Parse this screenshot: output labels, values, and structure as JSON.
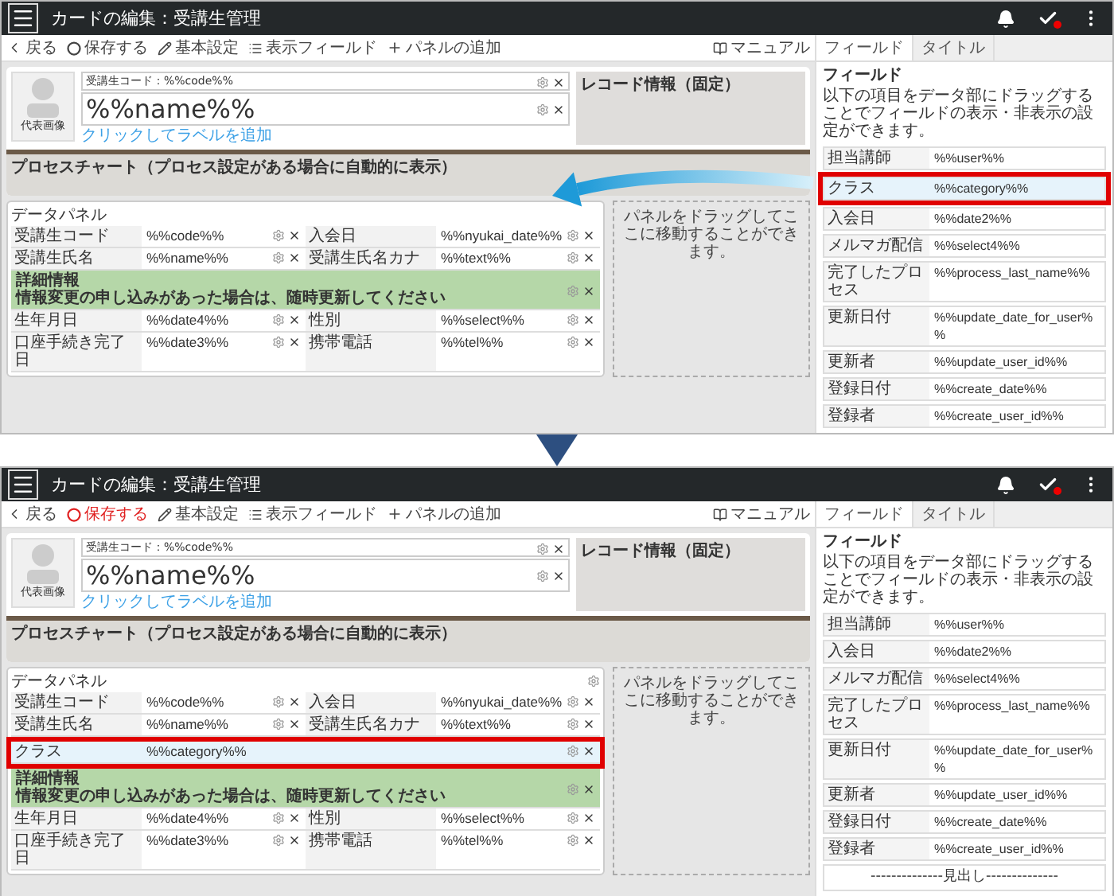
{
  "screens": [
    {
      "title": "カードの編集：受講生管理",
      "toolbar": [
        {
          "kind": "back",
          "label": "戻る",
          "active": false
        },
        {
          "kind": "save",
          "label": "保存する",
          "active": false
        },
        {
          "kind": "settings",
          "label": "基本設定",
          "active": false
        },
        {
          "kind": "fields",
          "label": "表示フィールド",
          "active": false
        },
        {
          "kind": "add",
          "label": "パネルの追加",
          "active": false
        }
      ],
      "manual": "マニュアル",
      "tabs": [
        {
          "label": "フィールド",
          "selected": true
        },
        {
          "label": "タイトル",
          "selected": false
        }
      ],
      "card": {
        "avatar_label": "代表画像",
        "code_label": "受講生コード：%%code%%",
        "name": "%%name%%",
        "label_link": "クリックしてラベルを追加",
        "record_info": "レコード情報（固定）"
      },
      "process_chart": "プロセスチャート（プロセス設定がある場合に自動的に表示）",
      "data_panel": {
        "title": "データパネル",
        "settings_icon": false,
        "rows": [
          {
            "kind": "pair",
            "highlighted": false,
            "cells": [
              {
                "label": "受講生コード",
                "value": "%%code%%"
              },
              {
                "label": "入会日",
                "value": "%%nyukai_date%%"
              }
            ]
          },
          {
            "kind": "pair",
            "highlighted": false,
            "cells": [
              {
                "label": "受講生氏名",
                "value": "%%name%%"
              },
              {
                "label": "受講生氏名カナ",
                "value": "%%text%%"
              }
            ]
          },
          {
            "kind": "section",
            "highlighted": false,
            "title": "詳細情報",
            "note": "情報変更の申し込みがあった場合は、随時更新してください"
          },
          {
            "kind": "pair",
            "highlighted": false,
            "cells": [
              {
                "label": "生年月日",
                "value": "%%date4%%"
              },
              {
                "label": "性別",
                "value": "%%select%%"
              }
            ]
          },
          {
            "kind": "pair",
            "highlighted": false,
            "cells": [
              {
                "label": "口座手続き完了日",
                "value": "%%date3%%"
              },
              {
                "label": "携帯電話",
                "value": "%%tel%%"
              }
            ]
          }
        ]
      },
      "drop_zone": "パネルをドラッグしてここに移動することができます。",
      "sidebar": {
        "heading": "フィールド",
        "description": "以下の項目をデータ部にドラッグすることでフィールドの表示・非表示の設定ができます。",
        "fields": [
          {
            "label": "担当講師",
            "value": "%%user%%",
            "highlighted": false
          },
          {
            "label": "クラス",
            "value": "%%category%%",
            "highlighted": true
          },
          {
            "label": "入会日",
            "value": "%%date2%%",
            "highlighted": false
          },
          {
            "label": "メルマガ配信",
            "value": "%%select4%%",
            "highlighted": false
          },
          {
            "label": "完了したプロセス",
            "value": "%%process_last_name%%",
            "highlighted": false
          },
          {
            "label": "更新日付",
            "value": "%%update_date_for_user%%",
            "highlighted": false
          },
          {
            "label": "更新者",
            "value": "%%update_user_id%%",
            "highlighted": false
          },
          {
            "label": "登録日付",
            "value": "%%create_date%%",
            "highlighted": false
          },
          {
            "label": "登録者",
            "value": "%%create_user_id%%",
            "highlighted": false
          }
        ]
      },
      "drag_arrow": true
    },
    {
      "title": "カードの編集：受講生管理",
      "toolbar": [
        {
          "kind": "back",
          "label": "戻る",
          "active": false
        },
        {
          "kind": "save",
          "label": "保存する",
          "active": true
        },
        {
          "kind": "settings",
          "label": "基本設定",
          "active": false
        },
        {
          "kind": "fields",
          "label": "表示フィールド",
          "active": false
        },
        {
          "kind": "add",
          "label": "パネルの追加",
          "active": false
        }
      ],
      "manual": "マニュアル",
      "tabs": [
        {
          "label": "フィールド",
          "selected": true
        },
        {
          "label": "タイトル",
          "selected": false
        }
      ],
      "card": {
        "avatar_label": "代表画像",
        "code_label": "受講生コード：%%code%%",
        "name": "%%name%%",
        "label_link": "クリックしてラベルを追加",
        "record_info": "レコード情報（固定）"
      },
      "process_chart": "プロセスチャート（プロセス設定がある場合に自動的に表示）",
      "data_panel": {
        "title": "データパネル",
        "settings_icon": true,
        "rows": [
          {
            "kind": "pair",
            "highlighted": false,
            "cells": [
              {
                "label": "受講生コード",
                "value": "%%code%%"
              },
              {
                "label": "入会日",
                "value": "%%nyukai_date%%"
              }
            ]
          },
          {
            "kind": "pair",
            "highlighted": false,
            "cells": [
              {
                "label": "受講生氏名",
                "value": "%%name%%"
              },
              {
                "label": "受講生氏名カナ",
                "value": "%%text%%"
              }
            ]
          },
          {
            "kind": "single",
            "highlighted": true,
            "label": "クラス",
            "value": "%%category%%"
          },
          {
            "kind": "section",
            "highlighted": false,
            "title": "詳細情報",
            "note": "情報変更の申し込みがあった場合は、随時更新してください"
          },
          {
            "kind": "pair",
            "highlighted": false,
            "cells": [
              {
                "label": "生年月日",
                "value": "%%date4%%"
              },
              {
                "label": "性別",
                "value": "%%select%%"
              }
            ]
          },
          {
            "kind": "pair",
            "highlighted": false,
            "cells": [
              {
                "label": "口座手続き完了日",
                "value": "%%date3%%"
              },
              {
                "label": "携帯電話",
                "value": "%%tel%%"
              }
            ]
          }
        ]
      },
      "drop_zone": "パネルをドラッグしてここに移動することができます。",
      "sidebar": {
        "heading": "フィールド",
        "description": "以下の項目をデータ部にドラッグすることでフィールドの表示・非表示の設定ができます。",
        "fields": [
          {
            "label": "担当講師",
            "value": "%%user%%",
            "highlighted": false
          },
          {
            "label": "入会日",
            "value": "%%date2%%",
            "highlighted": false
          },
          {
            "label": "メルマガ配信",
            "value": "%%select4%%",
            "highlighted": false
          },
          {
            "label": "完了したプロセス",
            "value": "%%process_last_name%%",
            "highlighted": false
          },
          {
            "label": "更新日付",
            "value": "%%update_date_for_user%%",
            "highlighted": false
          },
          {
            "label": "更新者",
            "value": "%%update_user_id%%",
            "highlighted": false
          },
          {
            "label": "登録日付",
            "value": "%%create_date%%",
            "highlighted": false
          },
          {
            "label": "登録者",
            "value": "%%create_user_id%%",
            "highlighted": false
          }
        ],
        "heading_item": "--------------見出し--------------"
      },
      "drag_arrow": false
    }
  ]
}
